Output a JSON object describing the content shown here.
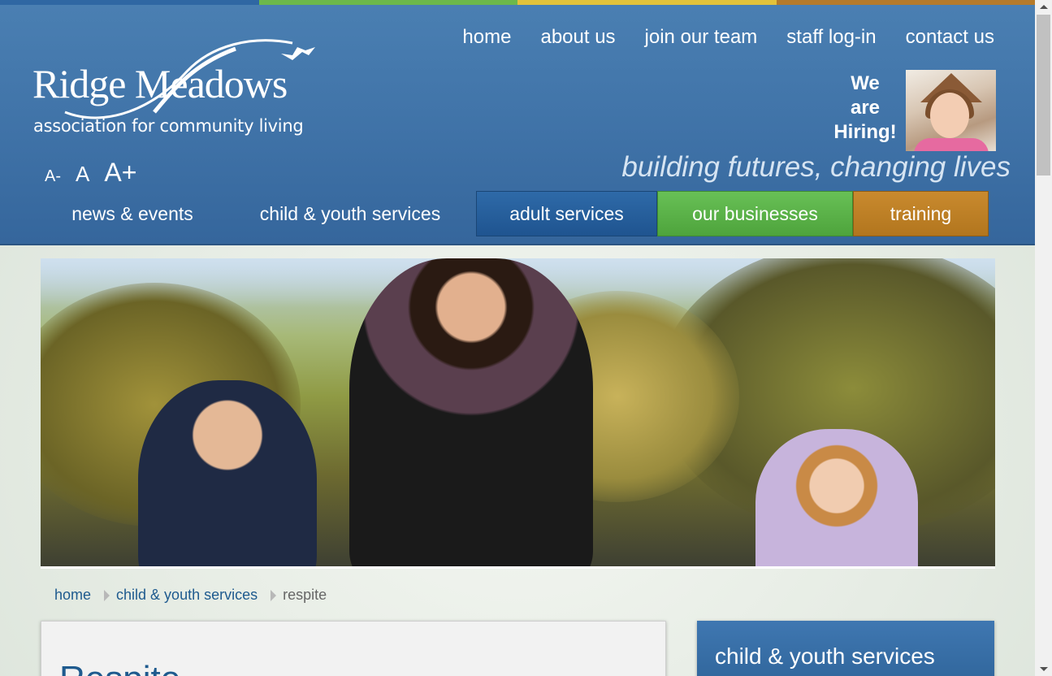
{
  "colors": {
    "strip": [
      "#2f67a3",
      "#6cb84b",
      "#e3c23a",
      "#b57a2a"
    ],
    "header": "#4579ad",
    "nav_adult": "#245c98",
    "nav_business": "#5cb247",
    "nav_training": "#bd7f25",
    "link": "#1e5a8e"
  },
  "logo": {
    "name": "Ridge Meadows",
    "tagline": "association for community living",
    "icon": "bird-swoosh-logo-icon"
  },
  "top_nav": [
    {
      "label": "home"
    },
    {
      "label": "about us"
    },
    {
      "label": "join our team"
    },
    {
      "label": "staff log-in"
    },
    {
      "label": "contact us"
    }
  ],
  "hiring": {
    "line1": "We",
    "line2": "are",
    "line3": "Hiring!",
    "photo": "girl-with-house-roof-photo"
  },
  "font_controls": {
    "decrease": "A-",
    "normal": "A",
    "increase": "A+"
  },
  "slogan": "building futures, changing lives",
  "main_nav": [
    {
      "label": "news & events"
    },
    {
      "label": "child & youth services"
    },
    {
      "label": "adult services"
    },
    {
      "label": "our businesses"
    },
    {
      "label": "training"
    }
  ],
  "hero": {
    "image": "family-walking-in-park-photo"
  },
  "breadcrumb": {
    "items": [
      {
        "label": "home"
      },
      {
        "label": "child & youth services"
      }
    ],
    "current": "respite",
    "separator_icon": "chevron-right-icon"
  },
  "page": {
    "title": "Respite"
  },
  "sidebar": {
    "title": "child & youth services"
  }
}
